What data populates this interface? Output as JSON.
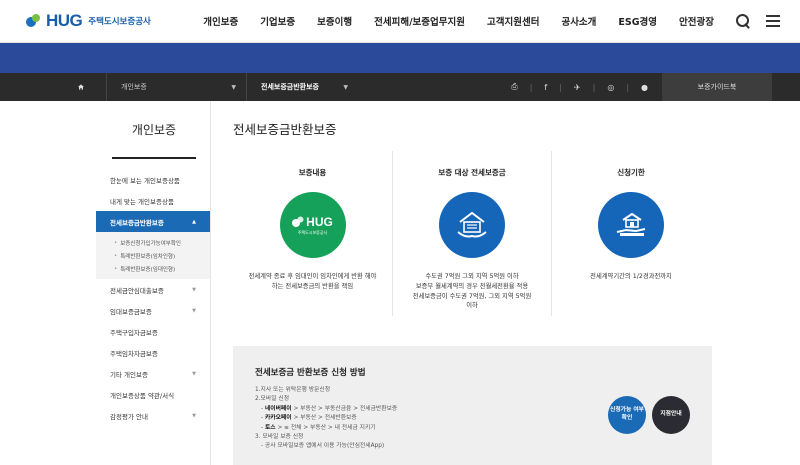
{
  "logo": {
    "brand": "HUG",
    "org": "주택도시보증공사"
  },
  "gnb": [
    "개인보증",
    "기업보증",
    "보증이행",
    "전세피해/보증업무지원",
    "고객지원센터",
    "공사소개",
    "ESG경영",
    "안전광장"
  ],
  "location": {
    "depth1": "개인보증",
    "depth2": "전세보증금반환보증",
    "guide_button": "보증가이드북"
  },
  "lnb": {
    "title": "개인보증",
    "items": [
      {
        "label": "한눈에 보는 개인보증상품",
        "arrow": ""
      },
      {
        "label": "내게 맞는 개인보증상품",
        "arrow": ""
      },
      {
        "label": "전세보증금반환보증",
        "arrow": "▲"
      },
      {
        "label": "전세금안심대출보증",
        "arrow": "▼"
      },
      {
        "label": "임대보증금보증",
        "arrow": "▼"
      },
      {
        "label": "주택구입자금보증",
        "arrow": ""
      },
      {
        "label": "주택임차자금보증",
        "arrow": ""
      },
      {
        "label": "기타 개인보증",
        "arrow": "▼"
      },
      {
        "label": "개인보증상품 약관/서식",
        "arrow": ""
      },
      {
        "label": "감정평가 안내",
        "arrow": "▼"
      }
    ],
    "sub_items": [
      "보증신청가입가능여부확인",
      "특례반환보증(임차인형)",
      "특례반환보증(임대인형)"
    ]
  },
  "main": {
    "title": "전세보증금반환보증",
    "columns": [
      {
        "title": "보증내용",
        "icon": "hug-logo-icon",
        "logo_text": "HUG",
        "logo_sub": "주택도시보증공사",
        "desc": [
          "전세계약 종료 후 임대인이 임차인에게 반환 해야",
          "하는 전세보증금의 반환을 책임"
        ]
      },
      {
        "title": "보증 대상 전세보증금",
        "icon": "house-deposit-icon",
        "desc": [
          "수도권 7억원 그외 지역 5억원 이하",
          "보증부 월세계약의 경우 전월세전환율 적용",
          "전세보증금이 수도권 7억원, 그외 지역 5억원",
          "이하"
        ]
      },
      {
        "title": "신청기한",
        "icon": "hand-house-icon",
        "desc": [
          "전세계약기간의 1/2경과전까지"
        ]
      }
    ]
  },
  "apply": {
    "title": "전세보증금 반환보증 신청 방법",
    "steps": [
      {
        "text": "1.지사 또는 위탁은행 방문신청",
        "indent": false
      },
      {
        "text": "2.모바일 신청",
        "indent": false
      },
      {
        "bold": "네이버페이",
        "text": " > 부동산 > 부동산금융 > 전세금반환보증",
        "indent": true
      },
      {
        "bold": "카카오페이",
        "text": " > 부동산 > 전세반환보증",
        "indent": true
      },
      {
        "bold": "토스",
        "text": " > ≡ 전체 > 부동산 > 내 전세금 지키기",
        "indent": true
      },
      {
        "text": "3. 모바일 보증 신청",
        "indent": false
      },
      {
        "text": "- 공사 모바일보증 앱에서 이용 가능(안심전세App)",
        "indent": true
      }
    ],
    "buttons": [
      "신청가능 여부확인",
      "지점안내"
    ]
  },
  "colors": {
    "primary": "#1b6ab5",
    "banner": "#2c4a9a",
    "green": "#15a15a",
    "dark": "#2b2b2b"
  }
}
